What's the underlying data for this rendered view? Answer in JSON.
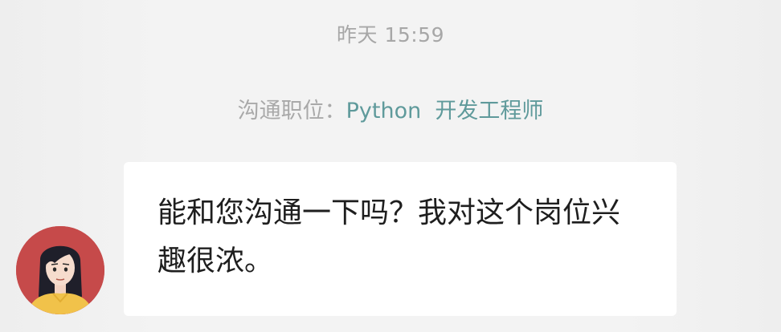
{
  "chat": {
    "timestamp": "昨天 15:59",
    "position_label": "沟通职位：",
    "position_value": "Python  开发工程师",
    "message": {
      "text": "能和您沟通一下吗？我对这个岗位兴趣很浓。"
    },
    "avatar_icon": "female-user-avatar",
    "colors": {
      "background": "#f2f2f2",
      "bubble": "#ffffff",
      "avatar_bg": "#c64a4a",
      "position_accent": "#5f9a9b",
      "meta_text": "#a9a9a9"
    }
  }
}
